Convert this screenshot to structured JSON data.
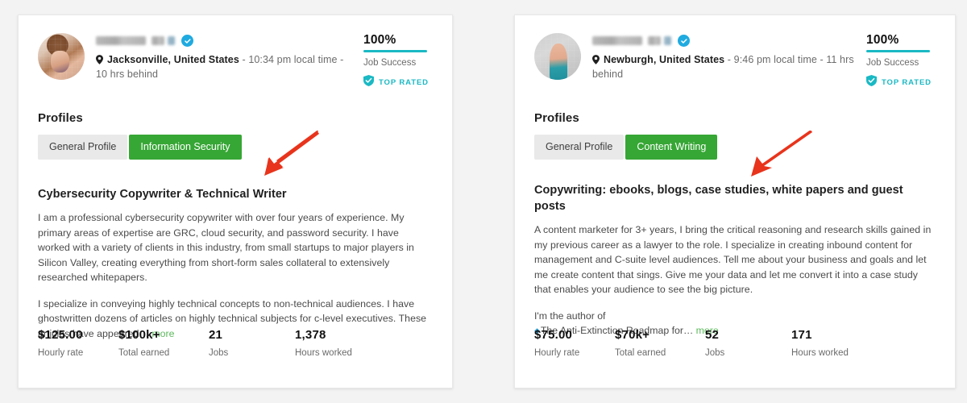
{
  "colors": {
    "page_bg": "#f3f3f3",
    "card_bg": "#ffffff",
    "accent_green": "#36a635",
    "link_green": "#5cb85c",
    "teal": "#1ab9c4",
    "verified_blue": "#1faae0",
    "arrow_red": "#e8341c",
    "diamond_blue": "#2e9fd4"
  },
  "cards": [
    {
      "avatar": "freelancer-photo-blurred",
      "name_redacted": true,
      "verified_icon": "verified-check-icon",
      "location_icon": "location-pin-icon",
      "location": "Jacksonville, United States",
      "separator": " - ",
      "local_time": "10:34 pm local time",
      "time_offset": "10 hrs behind",
      "job_success": {
        "percent": "100%",
        "label": "Job Success",
        "badge_icon": "shield-icon",
        "badge_label": "TOP RATED"
      },
      "profiles": {
        "heading": "Profiles",
        "tabs": [
          {
            "label": "General Profile",
            "active": false
          },
          {
            "label": "Information Security",
            "active": true
          }
        ]
      },
      "job_title": "Cybersecurity Copywriter & Technical Writer",
      "paragraphs": [
        "I am a professional cybersecurity copywriter with over four years of experience. My primary areas of expertise are GRC, cloud security, and password security. I have worked with a variety of clients in this industry, from small startups to major players in Silicon Valley, creating everything from short-form sales collateral to extensively researched whitepapers.",
        "I specialize in conveying highly technical concepts to non-technical audiences. I have ghostwritten dozens of articles on highly technical subjects for c-level executives. These articles have appeared…"
      ],
      "more_label": "more",
      "author_intro": null,
      "book_title": null,
      "stats": [
        {
          "value": "$125.00",
          "label": "Hourly rate"
        },
        {
          "value": "$100k+",
          "label": "Total earned"
        },
        {
          "value": "21",
          "label": "Jobs"
        },
        {
          "value": "1,378",
          "label": "Hours worked"
        }
      ],
      "annotation_arrow": "red-arrow-pointing-to-job-title"
    },
    {
      "avatar": "freelancer-photo-blurred",
      "name_redacted": true,
      "verified_icon": "verified-check-icon",
      "location_icon": "location-pin-icon",
      "location": "Newburgh, United States",
      "separator": " - ",
      "local_time": "9:46 pm local time",
      "time_offset": "11 hrs behind",
      "job_success": {
        "percent": "100%",
        "label": "Job Success",
        "badge_icon": "shield-icon",
        "badge_label": "TOP RATED"
      },
      "profiles": {
        "heading": "Profiles",
        "tabs": [
          {
            "label": "General Profile",
            "active": false
          },
          {
            "label": "Content Writing",
            "active": true
          }
        ]
      },
      "job_title": "Copywriting: ebooks, blogs, case studies, white papers and guest posts",
      "paragraphs": [
        "A content marketer for 3+ years, I bring the critical reasoning and research skills gained in my previous career as a lawyer to the role. I specialize in creating inbound content for management and C-suite level audiences. Tell me about your business and goals and let me create content that sings. Give me your data and let me convert it into a case study that enables your audience to see the big picture."
      ],
      "more_label": "more",
      "author_intro": "I'm the author of",
      "book_title": "The Anti-Extinction Roadmap for…",
      "stats": [
        {
          "value": "$75.00",
          "label": "Hourly rate"
        },
        {
          "value": "$70k+",
          "label": "Total earned"
        },
        {
          "value": "52",
          "label": "Jobs"
        },
        {
          "value": "171",
          "label": "Hours worked"
        }
      ],
      "annotation_arrow": "red-arrow-pointing-to-job-title"
    }
  ]
}
